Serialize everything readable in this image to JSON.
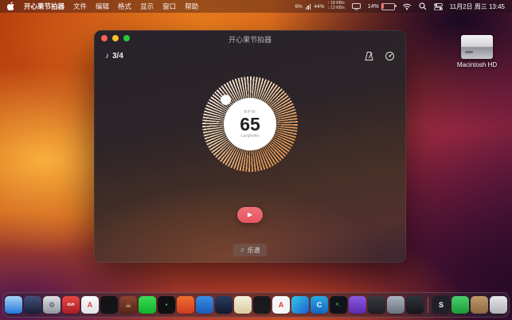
{
  "menu_bar": {
    "app_name": "开心果节拍器",
    "menus": [
      "文件",
      "编辑",
      "格式",
      "显示",
      "窗口",
      "帮助"
    ],
    "status": {
      "cpu": "6%",
      "mem": "44%",
      "net_up": "↑ 18 KB/s",
      "net_down": "↓ 13 KB/s",
      "battery": "14%",
      "datetime": "11月2日 周三 13:45"
    }
  },
  "window": {
    "title": "开心果节拍器",
    "time_signature": "3/4",
    "bpm": {
      "label": "BPM",
      "value": "65",
      "tempo": "Larghetto"
    },
    "score_button": "乐谱"
  },
  "icons": {
    "note": "♪",
    "play": "▶",
    "score": "♫"
  },
  "colors": {
    "play_button": "#e5555f",
    "dial_tint": "#e6a160",
    "battery_low": "#ff6159"
  },
  "desktop": {
    "volume_label": "Macintosh HD"
  },
  "dock": {
    "apps": [
      {
        "name": "finder",
        "bg": "linear-gradient(180deg,#a8d4f8,#2277dd)",
        "glyph": ""
      },
      {
        "name": "app-2",
        "bg": "linear-gradient(180deg,#44507a,#191f38)",
        "glyph": ""
      },
      {
        "name": "system-settings",
        "bg": "linear-gradient(180deg,#dcdee2,#9096a0)",
        "glyph": "⚙",
        "fg": "#4a4a50"
      },
      {
        "name": "app-duh",
        "bg": "linear-gradient(180deg,#e7473f,#a91d27)",
        "glyph": "duh",
        "size": "5px"
      },
      {
        "name": "app-store",
        "bg": "linear-gradient(180deg,#fafafa,#e2e2e6)",
        "glyph": "A",
        "fg": "#e0413c"
      },
      {
        "name": "app-6",
        "bg": "#141416",
        "glyph": ""
      },
      {
        "name": "coffee-app",
        "bg": "linear-gradient(180deg,#8a4530,#57251a)",
        "glyph": "☕",
        "fg": "#f0d0b0"
      },
      {
        "name": "wechat",
        "bg": "linear-gradient(180deg,#3ddb55,#0fb32a)",
        "glyph": ""
      },
      {
        "name": "app-9",
        "bg": "#101014",
        "glyph": "●",
        "fg": "#35d04a",
        "size": "5px"
      },
      {
        "name": "app-10",
        "bg": "linear-gradient(180deg,#f07030,#d03a20)",
        "glyph": ""
      },
      {
        "name": "app-11",
        "bg": "linear-gradient(180deg,#3a8ee6,#1a5cb8)",
        "glyph": ""
      },
      {
        "name": "app-12",
        "bg": "linear-gradient(180deg,#2a3a5e,#121a30)",
        "glyph": ""
      },
      {
        "name": "app-13",
        "bg": "linear-gradient(180deg,#f5f0dc,#d8cba0)",
        "glyph": ""
      },
      {
        "name": "app-14",
        "bg": "#1a1a1e",
        "glyph": ""
      },
      {
        "name": "app-a",
        "bg": "#f5f5f7",
        "glyph": "A",
        "fg": "#e03535"
      },
      {
        "name": "app-16",
        "bg": "linear-gradient(135deg,#35c8e8,#1a5fd0)",
        "glyph": ""
      },
      {
        "name": "app-c",
        "bg": "linear-gradient(180deg,#2aa8e0,#1565c0)",
        "glyph": "C"
      },
      {
        "name": "terminal",
        "bg": "#10141a",
        "glyph": ">_",
        "fg": "#3ddb55",
        "size": "6px"
      },
      {
        "name": "app-19",
        "bg": "linear-gradient(180deg,#8a5ae0,#5a2ab0)",
        "glyph": ""
      },
      {
        "name": "app-20",
        "bg": "linear-gradient(180deg,#3a3a40,#1c1c22)",
        "glyph": ""
      },
      {
        "name": "app-21",
        "bg": "linear-gradient(180deg,#aab2c0,#6a7280)",
        "glyph": ""
      },
      {
        "name": "app-22",
        "bg": "linear-gradient(180deg,#30343c,#14161c)",
        "glyph": ""
      },
      {
        "separator": true
      },
      {
        "name": "app-s",
        "bg": "#202028",
        "glyph": "S"
      },
      {
        "name": "app-24",
        "bg": "linear-gradient(180deg,#4ad06a,#1a9a3a)",
        "glyph": ""
      },
      {
        "name": "downloads",
        "bg": "linear-gradient(180deg,#c09a6a,#8a6a42)",
        "glyph": ""
      },
      {
        "name": "trash",
        "bg": "linear-gradient(180deg,#e8e8ec,#b0b0b8)",
        "glyph": ""
      }
    ]
  }
}
